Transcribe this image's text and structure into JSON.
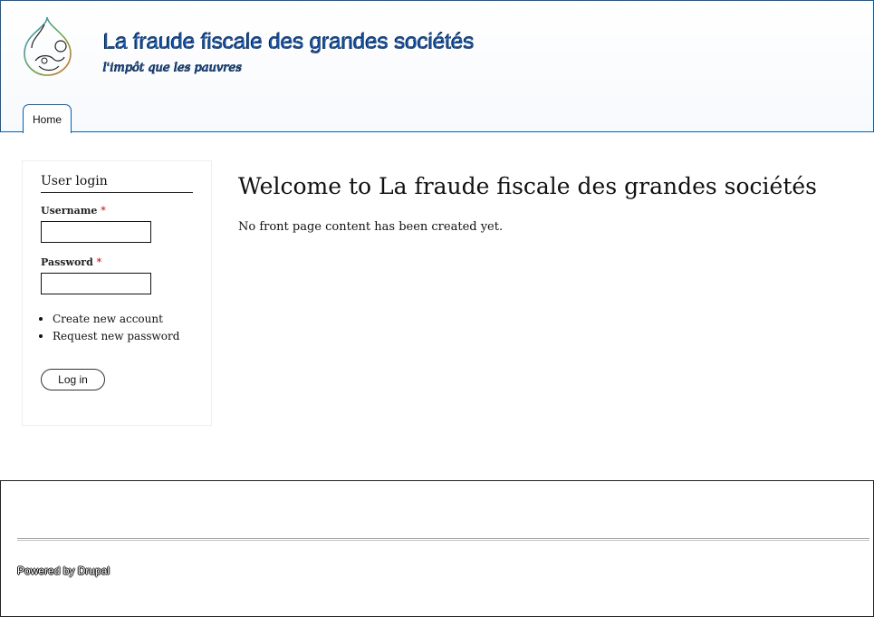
{
  "header": {
    "site_name": "La fraude fiscale des grandes sociétés",
    "slogan": "l'impôt que les pauvres",
    "logo_icon": "drupal-drop-icon"
  },
  "nav": {
    "tabs": [
      {
        "label": "Home",
        "active": true
      }
    ]
  },
  "sidebar": {
    "block_title": "User login",
    "username_label": "Username",
    "password_label": "Password",
    "required_marker": "*",
    "username_value": "",
    "password_value": "",
    "links": [
      "Create new account",
      "Request new password"
    ],
    "login_button": "Log in"
  },
  "main": {
    "title": "Welcome to La fraude fiscale des grandes sociétés",
    "body": "No front page content has been created yet."
  },
  "footer": {
    "powered_by": "Powered by Drupal"
  },
  "colors": {
    "accent": "#1257b5",
    "border": "#0b5ea8"
  }
}
